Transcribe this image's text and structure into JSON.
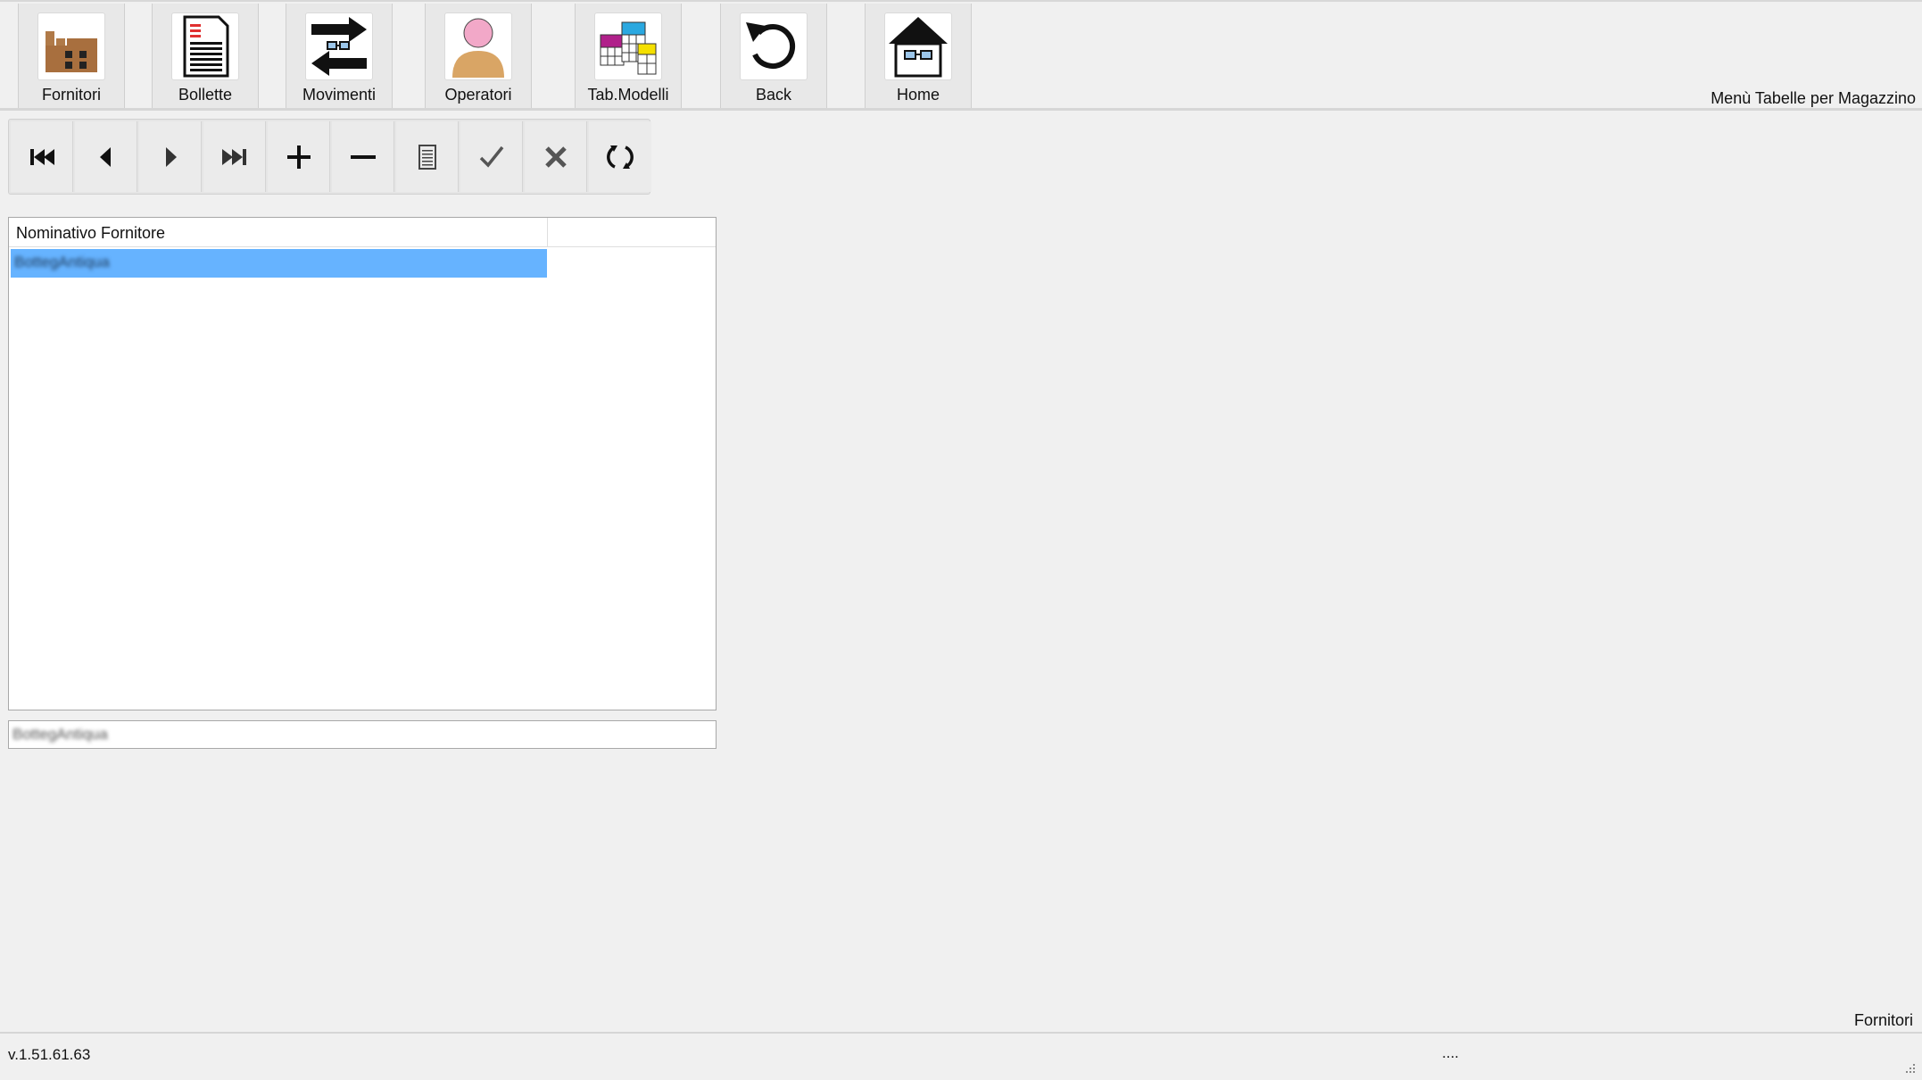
{
  "toolbar": {
    "items": [
      {
        "label": "Fornitori",
        "icon": "factory-icon"
      },
      {
        "label": "Bollette",
        "icon": "document-icon"
      },
      {
        "label": "Movimenti",
        "icon": "transfer-arrows-icon"
      },
      {
        "label": "Operatori",
        "icon": "person-icon"
      },
      {
        "label": "Tab.Modelli",
        "icon": "colored-tables-icon"
      },
      {
        "label": "Back",
        "icon": "undo-arrow-icon"
      },
      {
        "label": "Home",
        "icon": "house-icon"
      }
    ]
  },
  "menu_title": "Menù Tabelle per Magazzino",
  "navigator": {
    "buttons": [
      "first-record",
      "previous-record",
      "next-record",
      "last-record",
      "add-record",
      "delete-record",
      "edit-record",
      "confirm",
      "cancel",
      "refresh"
    ]
  },
  "grid": {
    "columns": [
      "Nominativo Fornitore",
      ""
    ],
    "rows": [
      [
        "BottegAntiqua",
        ""
      ]
    ]
  },
  "detail_field": {
    "value": "BottegAntiqua"
  },
  "form_name": "Fornitori",
  "status": {
    "version": "v.1.51.61.63",
    "indicator": "...."
  },
  "colors": {
    "selection": "#66b3ff",
    "background": "#f0f0f0"
  }
}
